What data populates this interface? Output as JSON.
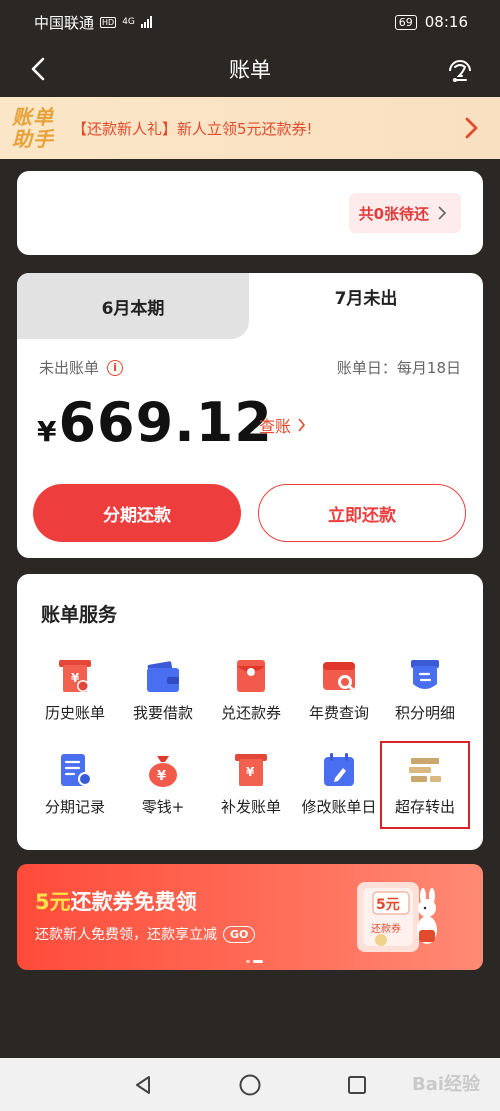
{
  "status_bar": {
    "carrier": "中国联通",
    "hd": "HD",
    "network": "4G",
    "battery": "69",
    "time": "08:16"
  },
  "nav": {
    "title": "账单"
  },
  "helper_banner": {
    "logo_line1": "账单",
    "logo_line2": "助手",
    "text": "【还款新人礼】新人立领5元还款券!"
  },
  "pending": {
    "text": "共0张待还"
  },
  "bill_tabs": [
    {
      "label": "6月本期",
      "active": false
    },
    {
      "label": "7月未出",
      "active": true
    }
  ],
  "bill": {
    "status_label": "未出账单",
    "due_day": "账单日：每月18日",
    "currency": "¥",
    "amount": "669.12",
    "check_link": "查账"
  },
  "actions": {
    "installment": "分期还款",
    "repay_now": "立即还款"
  },
  "services": {
    "title": "账单服务",
    "items": [
      {
        "label": "历史账单",
        "icon": "history-bill-icon"
      },
      {
        "label": "我要借款",
        "icon": "wallet-icon"
      },
      {
        "label": "兑还款券",
        "icon": "red-envelope-icon"
      },
      {
        "label": "年费查询",
        "icon": "annual-fee-search-icon"
      },
      {
        "label": "积分明细",
        "icon": "points-icon"
      },
      {
        "label": "分期记录",
        "icon": "installment-record-icon"
      },
      {
        "label": "零钱+",
        "icon": "money-bag-icon"
      },
      {
        "label": "补发账单",
        "icon": "reissue-bill-icon"
      },
      {
        "label": "修改账单日",
        "icon": "calendar-edit-icon"
      },
      {
        "label": "超存转出",
        "icon": "overflow-transfer-icon"
      }
    ]
  },
  "promo": {
    "title_highlight": "5元",
    "title_rest": "还款券免费领",
    "subtitle": "还款新人免费领，还款享立减",
    "go": "GO",
    "coupon_amount": "5元",
    "coupon_label": "还款券"
  },
  "watermark": "Bai经验",
  "colors": {
    "accent": "#ee3d3d",
    "background": "#2b2724",
    "banner": "#fbe6c8",
    "gold": "#e8a23a"
  }
}
